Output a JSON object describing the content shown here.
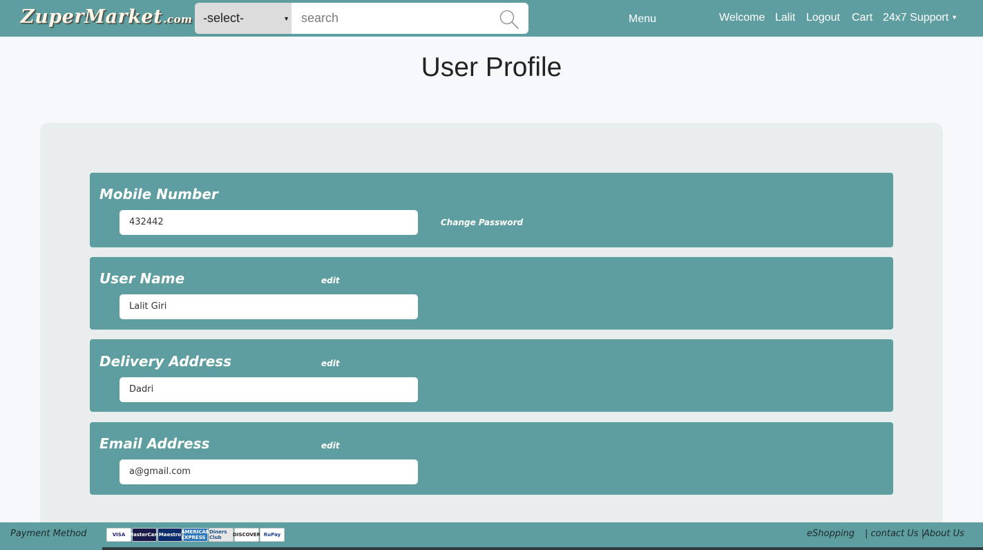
{
  "navbar": {
    "brand": "ZuperMarket",
    "brand_suffix": ".com",
    "category_select": "-select-",
    "search_placeholder": "search",
    "menu": "Menu",
    "welcome": "Welcome",
    "user": "Lalit",
    "logout": "Logout",
    "cart": "Cart",
    "support": "24x7 Support"
  },
  "page": {
    "title": "User Profile"
  },
  "profile": {
    "mobile": {
      "label": "Mobile Number",
      "value": "432442",
      "change_password": "Change Password"
    },
    "username": {
      "label": "User Name",
      "value": "Lalit Giri",
      "edit": "edit"
    },
    "address": {
      "label": "Delivery Address",
      "value": "Dadri",
      "edit": "edit"
    },
    "email": {
      "label": "Email Address",
      "value": "a@gmail.com",
      "edit": "edit"
    }
  },
  "footer": {
    "payment_method": "Payment Method",
    "cards": [
      {
        "label": "VISA",
        "bg": "#ffffff",
        "fg": "#1a1f71"
      },
      {
        "label": "MasterCard",
        "bg": "#1a1a4a",
        "fg": "#ffffff"
      },
      {
        "label": "Maestro",
        "bg": "#0b2c6b",
        "fg": "#ffffff"
      },
      {
        "label": "AMERICAN EXPRESS",
        "bg": "#2e77bb",
        "fg": "#ffffff"
      },
      {
        "label": "Diners Club",
        "bg": "#e6e6e6",
        "fg": "#1b4f8a"
      },
      {
        "label": "DISCOVER",
        "bg": "#ffffff",
        "fg": "#222222"
      },
      {
        "label": "RuPay",
        "bg": "#ffffff",
        "fg": "#1c3f94"
      }
    ],
    "eshopping": "eShopping",
    "contact": "| contact Us |",
    "about": "About Us"
  },
  "colors": {
    "accent": "#5f9ea0",
    "panel": "#e8eded",
    "background": "#f6f8fc"
  }
}
